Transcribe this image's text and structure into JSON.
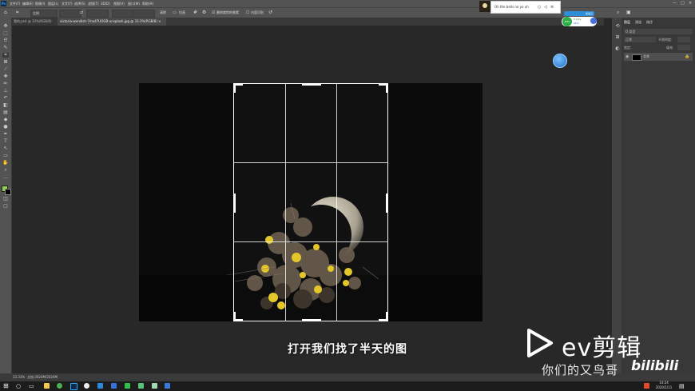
{
  "app": {
    "icon_label": "Ps"
  },
  "menu": [
    "文件(F)",
    "编辑(E)",
    "图像(I)",
    "图层(L)",
    "文字(Y)",
    "选择(S)",
    "滤镜(T)",
    "3D(D)",
    "视图(V)",
    "窗口(W)",
    "帮助(H)"
  ],
  "options_bar": {
    "ratio": "比例",
    "clear": "清除",
    "straighten": "拉直",
    "delete_cropped": "删除裁剪的像素",
    "content_aware": "内容识别"
  },
  "tabs": [
    {
      "label": "我的.psd @ 33%(RGB/8) ×"
    },
    {
      "label": "victoria-wendish-7mo47UOGB-unsplash.jpg @ 33.3%(RGB/8) ×"
    }
  ],
  "right_panel": {
    "tabs": [
      "图层",
      "通道",
      "路径"
    ],
    "kind": "Q 类型",
    "blend": "正常",
    "opacity": "不透明度:",
    "lock": "锁定:",
    "fill": "填充:",
    "layer_name": "背景"
  },
  "status": {
    "zoom": "33.33%",
    "doc": "文档:2024M/2024M"
  },
  "music": {
    "text": "Oh the bells no yo uh"
  },
  "net_widget": {
    "percent": "40%",
    "up": "0.1K/s",
    "down": "0K/s",
    "badge": "加速云"
  },
  "taskbar": {
    "time": "14:24",
    "date": "2020/1/11"
  },
  "subtitle": "打开我们找了半天的图",
  "watermark": {
    "logo_text": "ev剪辑",
    "tagline": "你们的又鸟哥",
    "site": "bilibili"
  },
  "colors": {
    "accent": "#31a8ff",
    "crop_frame": "#ffffff",
    "canvas_bg": "#282828"
  }
}
